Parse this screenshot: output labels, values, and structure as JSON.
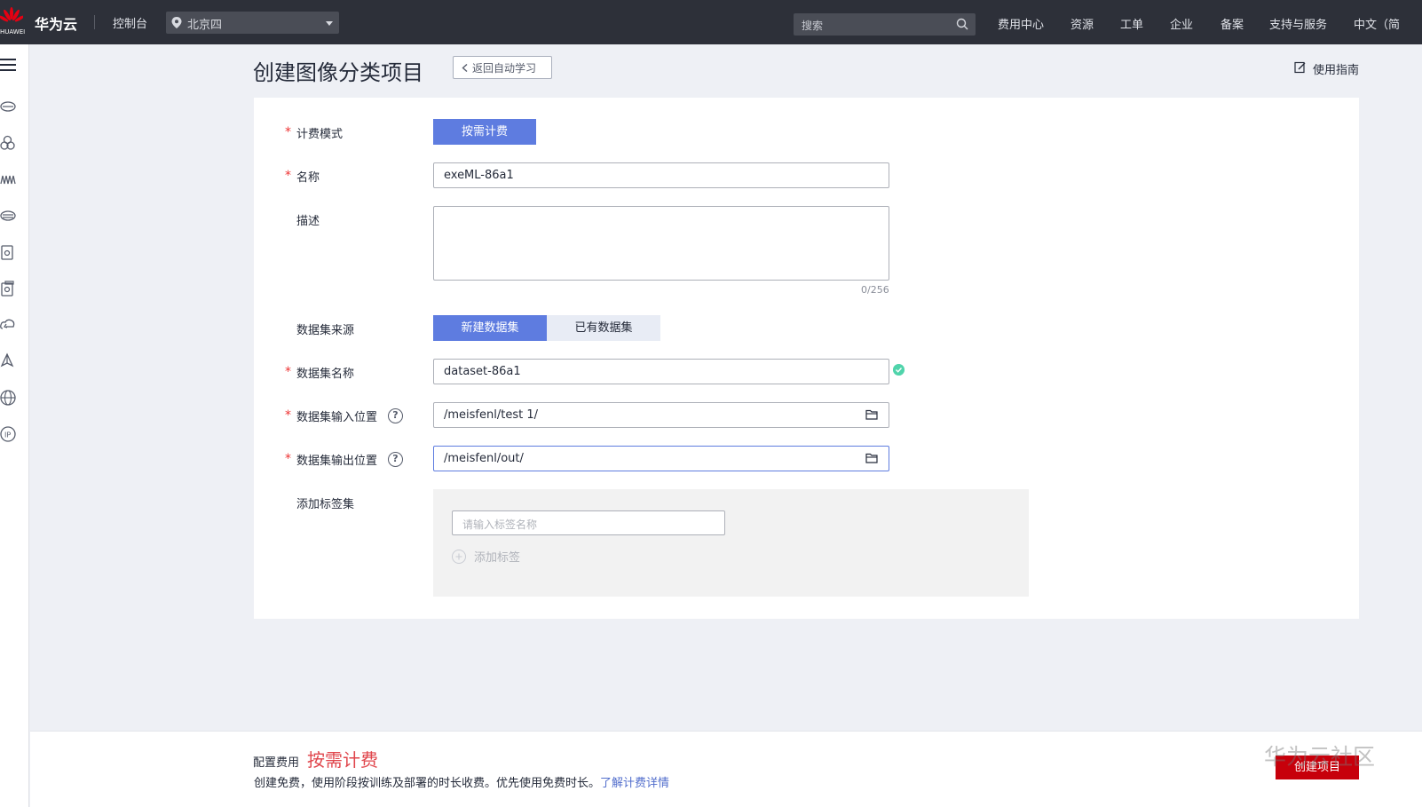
{
  "topbar": {
    "logo_text": "HUAWEI",
    "brand": "华为云",
    "console": "控制台",
    "region": "北京四",
    "search_placeholder": "搜索",
    "nav": [
      "费用中心",
      "资源",
      "工单",
      "企业",
      "备案",
      "支持与服务",
      "中文（简"
    ]
  },
  "sidebar": {
    "icons": [
      "menu-icon",
      "cloud-server-icon",
      "cluster-icon",
      "network-icon",
      "storage-icon",
      "database-icon",
      "security-icon",
      "cloud-icon",
      "deploy-icon",
      "globe-icon",
      "ip-icon"
    ]
  },
  "header": {
    "title": "创建图像分类项目",
    "back_label": "返回自动学习",
    "guide_label": "使用指南"
  },
  "form": {
    "billing_mode": {
      "label": "计费模式",
      "value": "按需计费"
    },
    "name": {
      "label": "名称",
      "value": "exeML-86a1"
    },
    "description": {
      "label": "描述",
      "value": "",
      "counter": "0/256"
    },
    "dataset_source": {
      "label": "数据集来源",
      "options": [
        "新建数据集",
        "已有数据集"
      ],
      "selected": "新建数据集"
    },
    "dataset_name": {
      "label": "数据集名称",
      "value": "dataset-86a1"
    },
    "dataset_input": {
      "label": "数据集输入位置",
      "value": "/meisfenl/test 1/"
    },
    "dataset_output": {
      "label": "数据集输出位置",
      "value": "/meisfenl/out/"
    },
    "tag_set": {
      "label": "添加标签集",
      "placeholder": "请输入标签名称",
      "add_label": "添加标签"
    },
    "required_mark": "*",
    "help_mark": "?"
  },
  "bottom": {
    "fee_label": "配置费用",
    "fee_value": "按需计费",
    "fee_desc": "创建免费，使用阶段按训练及部署的时长收费。优先使用免费时长。",
    "fee_link": "了解计费详情",
    "create_label": "创建项目",
    "watermark": "华为云社区"
  },
  "colors": {
    "topbar": "#2d3039",
    "primary": "#5e7ce0",
    "danger": "#c7000b",
    "price": "#e0464c",
    "link": "#526ecc"
  }
}
